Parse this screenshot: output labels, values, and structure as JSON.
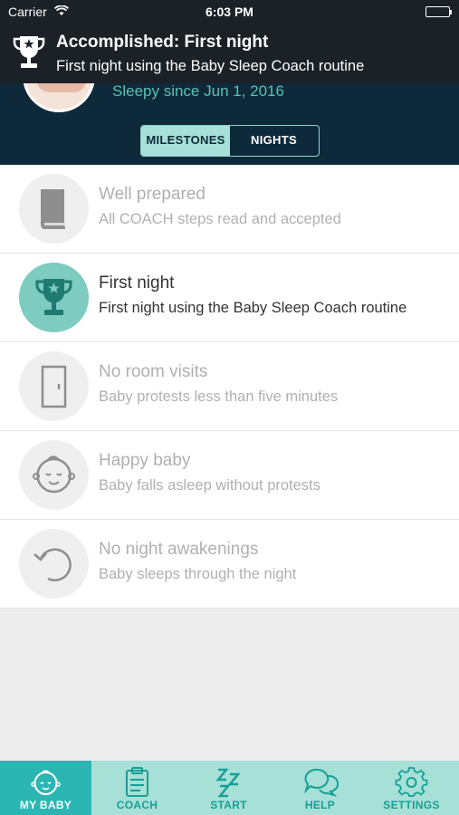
{
  "status_bar": {
    "carrier": "Carrier",
    "time": "6:03 PM"
  },
  "notification": {
    "title": "Accomplished: First night",
    "subtitle": "First night using the Baby Sleep Coach routine"
  },
  "profile": {
    "sleepy_since": "Sleepy since Jun 1, 2016"
  },
  "segments": {
    "milestones": "MILESTONES",
    "nights": "NIGHTS"
  },
  "milestones": [
    {
      "title": "Well prepared",
      "subtitle": "All COACH steps read and accepted",
      "icon": "book-icon",
      "accomplished": false
    },
    {
      "title": "First night",
      "subtitle": "First night using the Baby Sleep Coach routine",
      "icon": "trophy-icon",
      "accomplished": true
    },
    {
      "title": "No room visits",
      "subtitle": "Baby protests less than five minutes",
      "icon": "door-icon",
      "accomplished": false
    },
    {
      "title": "Happy baby",
      "subtitle": "Baby falls asleep without protests",
      "icon": "baby-face-icon",
      "accomplished": false
    },
    {
      "title": "No night awakenings",
      "subtitle": "Baby sleeps through the night",
      "icon": "replay-icon",
      "accomplished": false
    }
  ],
  "tabs": [
    {
      "label": "MY BABY",
      "icon": "baby-face-icon",
      "selected": true
    },
    {
      "label": "COACH",
      "icon": "clipboard-icon",
      "selected": false
    },
    {
      "label": "START",
      "icon": "zzz-icon",
      "selected": false
    },
    {
      "label": "HELP",
      "icon": "chat-bubbles-icon",
      "selected": false
    },
    {
      "label": "SETTINGS",
      "icon": "gear-icon",
      "selected": false
    }
  ],
  "colors": {
    "header_bg": "#0e2a3a",
    "accent_teal": "#7ecbbf",
    "tab_selected": "#2bb6b3",
    "tabbar_bg": "#a6e0d6"
  }
}
